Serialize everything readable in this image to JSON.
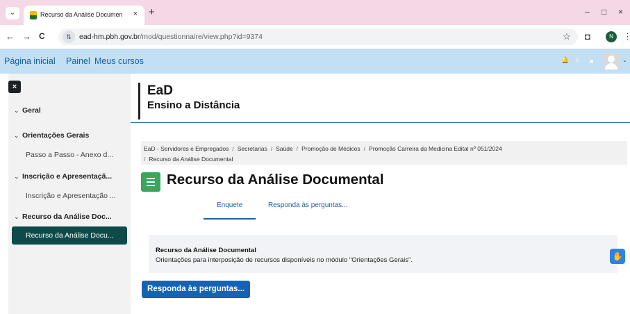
{
  "browser": {
    "tab_title": "Recurso da Análise Documental",
    "tab_close": "×",
    "new_tab": "+",
    "chevron": "⌄",
    "url_host": "ead-hm.pbh.gov.br",
    "url_path": "/mod/questionnaire/view.php?id=9374",
    "profile_initial": "N",
    "win_minimize": "–",
    "win_maximize": "□",
    "win_close": "×",
    "back_icon": "←",
    "forward_icon": "→",
    "reload_icon": "C",
    "star_icon": "☆",
    "extensions_icon": "◘",
    "menu_icon": "⋮",
    "site_info_icon": "⇅"
  },
  "navbar": {
    "home": "Página inicial",
    "dashboard": "Painel",
    "my_courses": "Meus cursos",
    "bell_icon": "🔔",
    "chat_icon": "○",
    "mail_icon": "■",
    "avatar_caret": "⌄"
  },
  "drawer": {
    "close_label": "×",
    "sections": [
      {
        "title": "Geral",
        "chevron": "⌄"
      },
      {
        "title": "Orientações Gerais",
        "chevron": "⌄",
        "item": "Passo a Passo - Anexo d..."
      },
      {
        "title": "Inscrição e Apresentaçã...",
        "chevron": "⌄",
        "item": "Inscrição e Apresentação ..."
      },
      {
        "title": "Recurso da Análise Doc...",
        "chevron": "⌄",
        "item": "Recurso da Análise Docu..."
      }
    ]
  },
  "brand": {
    "line1": "EaD",
    "line2": "Ensino a Distância"
  },
  "breadcrumb": {
    "items": [
      "EaD - Servidores e Empregados",
      "Secretarias",
      "Saúde",
      "Promoção de Médicos",
      "Promoção Carreira da Medicina Edital nº 051/2024",
      "Recurso da Análise Documental"
    ],
    "separator": "/"
  },
  "page": {
    "title": "Recurso da Análise Documental",
    "tabs": [
      {
        "label": "Enquete",
        "active": true
      },
      {
        "label": "Responda às perguntas...",
        "active": false
      }
    ]
  },
  "info": {
    "title": "Recurso da Análise Documental",
    "text": "Orientações para interposição de recursos disponíveis no módulo \"Orientações Gerais\"."
  },
  "actions": {
    "respond_button": "Responda às perguntas...",
    "accessibility_icon": "✋"
  },
  "colors": {
    "tab_bar": "#f5d8e6",
    "navbar": "#c2dff4",
    "link": "#1a5fa6",
    "active_item": "#0f4a4a",
    "primary_button": "#1663b5",
    "page_icon": "#3ba55c"
  }
}
